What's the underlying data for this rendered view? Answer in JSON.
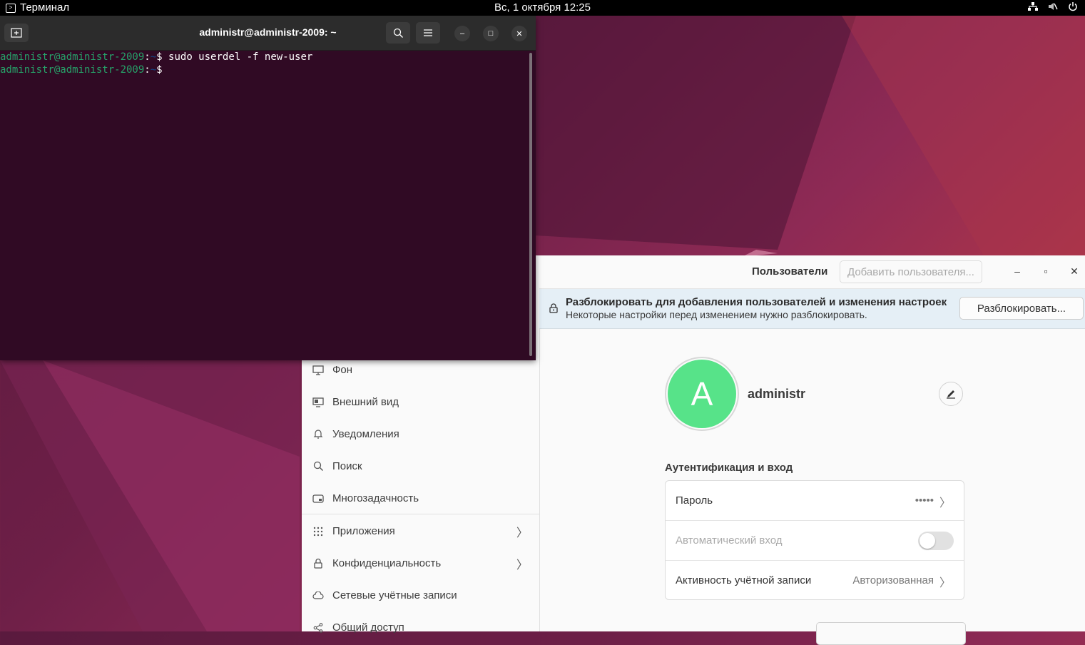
{
  "topbar": {
    "app_name": "Терминал",
    "clock": "Вс, 1 октября  12:25",
    "tray": [
      "network-icon",
      "volume-muted-icon",
      "power-icon"
    ]
  },
  "terminal": {
    "title": "administr@administr-2009: ~",
    "lines": [
      {
        "user": "administr@administr-2009",
        "sep": ":",
        "path": "~",
        "prompt": "$ ",
        "command": "sudo userdel -f new-user"
      },
      {
        "user": "administr@administr-2009",
        "sep": ":",
        "path": "~",
        "prompt": "$",
        "command": ""
      }
    ]
  },
  "settings": {
    "header": {
      "title": "Пользователи",
      "add_user": "Добавить пользователя..."
    },
    "banner": {
      "title": "Разблокировать для добавления пользователей и изменения настроек",
      "subtitle": "Некоторые настройки перед изменением нужно разблокировать.",
      "unlock_button": "Разблокировать..."
    },
    "sidebar": {
      "items": [
        {
          "label": "Фон",
          "icon": "monitor-icon",
          "chevron": false
        },
        {
          "label": "Внешний вид",
          "icon": "appearance-icon",
          "chevron": false
        },
        {
          "label": "Уведомления",
          "icon": "bell-icon",
          "chevron": false
        },
        {
          "label": "Поиск",
          "icon": "search-icon",
          "chevron": false
        },
        {
          "label": "Многозадачность",
          "icon": "multitasking-icon",
          "chevron": false
        },
        {
          "label": "Приложения",
          "icon": "apps-grid-icon",
          "chevron": true
        },
        {
          "label": "Конфиденциальность",
          "icon": "lock-icon",
          "chevron": true
        },
        {
          "label": "Сетевые учётные записи",
          "icon": "cloud-icon",
          "chevron": false
        },
        {
          "label": "Общий доступ",
          "icon": "share-icon",
          "chevron": false
        }
      ]
    },
    "user": {
      "avatar_letter": "A",
      "avatar_color": "#57e389",
      "name": "administr"
    },
    "auth": {
      "section_title": "Аутентификация и вход",
      "password_label": "Пароль",
      "password_value": "•••••",
      "autologin_label": "Автоматический вход",
      "autologin_enabled": false,
      "activity_label": "Активность учётной записи",
      "activity_value": "Авторизованная"
    }
  }
}
